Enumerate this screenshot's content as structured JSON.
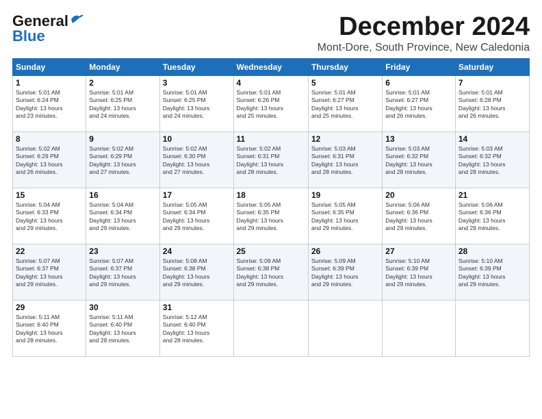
{
  "header": {
    "logo_general": "General",
    "logo_blue": "Blue",
    "month_title": "December 2024",
    "location": "Mont-Dore, South Province, New Caledonia"
  },
  "weekdays": [
    "Sunday",
    "Monday",
    "Tuesday",
    "Wednesday",
    "Thursday",
    "Friday",
    "Saturday"
  ],
  "weeks": [
    [
      {
        "day": "1",
        "sunrise": "5:01 AM",
        "sunset": "6:24 PM",
        "daylight": "13 hours and 23 minutes."
      },
      {
        "day": "2",
        "sunrise": "5:01 AM",
        "sunset": "6:25 PM",
        "daylight": "13 hours and 24 minutes."
      },
      {
        "day": "3",
        "sunrise": "5:01 AM",
        "sunset": "6:25 PM",
        "daylight": "13 hours and 24 minutes."
      },
      {
        "day": "4",
        "sunrise": "5:01 AM",
        "sunset": "6:26 PM",
        "daylight": "13 hours and 25 minutes."
      },
      {
        "day": "5",
        "sunrise": "5:01 AM",
        "sunset": "6:27 PM",
        "daylight": "13 hours and 25 minutes."
      },
      {
        "day": "6",
        "sunrise": "5:01 AM",
        "sunset": "6:27 PM",
        "daylight": "13 hours and 26 minutes."
      },
      {
        "day": "7",
        "sunrise": "5:01 AM",
        "sunset": "6:28 PM",
        "daylight": "13 hours and 26 minutes."
      }
    ],
    [
      {
        "day": "8",
        "sunrise": "5:02 AM",
        "sunset": "6:29 PM",
        "daylight": "13 hours and 26 minutes."
      },
      {
        "day": "9",
        "sunrise": "5:02 AM",
        "sunset": "6:29 PM",
        "daylight": "13 hours and 27 minutes."
      },
      {
        "day": "10",
        "sunrise": "5:02 AM",
        "sunset": "6:30 PM",
        "daylight": "13 hours and 27 minutes."
      },
      {
        "day": "11",
        "sunrise": "5:02 AM",
        "sunset": "6:31 PM",
        "daylight": "13 hours and 28 minutes."
      },
      {
        "day": "12",
        "sunrise": "5:03 AM",
        "sunset": "6:31 PM",
        "daylight": "13 hours and 28 minutes."
      },
      {
        "day": "13",
        "sunrise": "5:03 AM",
        "sunset": "6:32 PM",
        "daylight": "13 hours and 28 minutes."
      },
      {
        "day": "14",
        "sunrise": "5:03 AM",
        "sunset": "6:32 PM",
        "daylight": "13 hours and 28 minutes."
      }
    ],
    [
      {
        "day": "15",
        "sunrise": "5:04 AM",
        "sunset": "6:33 PM",
        "daylight": "13 hours and 29 minutes."
      },
      {
        "day": "16",
        "sunrise": "5:04 AM",
        "sunset": "6:34 PM",
        "daylight": "13 hours and 29 minutes."
      },
      {
        "day": "17",
        "sunrise": "5:05 AM",
        "sunset": "6:34 PM",
        "daylight": "13 hours and 29 minutes."
      },
      {
        "day": "18",
        "sunrise": "5:05 AM",
        "sunset": "6:35 PM",
        "daylight": "13 hours and 29 minutes."
      },
      {
        "day": "19",
        "sunrise": "5:05 AM",
        "sunset": "6:35 PM",
        "daylight": "13 hours and 29 minutes."
      },
      {
        "day": "20",
        "sunrise": "5:06 AM",
        "sunset": "6:36 PM",
        "daylight": "13 hours and 29 minutes."
      },
      {
        "day": "21",
        "sunrise": "5:06 AM",
        "sunset": "6:36 PM",
        "daylight": "13 hours and 29 minutes."
      }
    ],
    [
      {
        "day": "22",
        "sunrise": "5:07 AM",
        "sunset": "6:37 PM",
        "daylight": "13 hours and 29 minutes."
      },
      {
        "day": "23",
        "sunrise": "5:07 AM",
        "sunset": "6:37 PM",
        "daylight": "13 hours and 29 minutes."
      },
      {
        "day": "24",
        "sunrise": "5:08 AM",
        "sunset": "6:38 PM",
        "daylight": "13 hours and 29 minutes."
      },
      {
        "day": "25",
        "sunrise": "5:09 AM",
        "sunset": "6:38 PM",
        "daylight": "13 hours and 29 minutes."
      },
      {
        "day": "26",
        "sunrise": "5:09 AM",
        "sunset": "6:39 PM",
        "daylight": "13 hours and 29 minutes."
      },
      {
        "day": "27",
        "sunrise": "5:10 AM",
        "sunset": "6:39 PM",
        "daylight": "13 hours and 29 minutes."
      },
      {
        "day": "28",
        "sunrise": "5:10 AM",
        "sunset": "6:39 PM",
        "daylight": "13 hours and 29 minutes."
      }
    ],
    [
      {
        "day": "29",
        "sunrise": "5:11 AM",
        "sunset": "6:40 PM",
        "daylight": "13 hours and 28 minutes."
      },
      {
        "day": "30",
        "sunrise": "5:11 AM",
        "sunset": "6:40 PM",
        "daylight": "13 hours and 28 minutes."
      },
      {
        "day": "31",
        "sunrise": "5:12 AM",
        "sunset": "6:40 PM",
        "daylight": "13 hours and 28 minutes."
      },
      null,
      null,
      null,
      null
    ]
  ]
}
